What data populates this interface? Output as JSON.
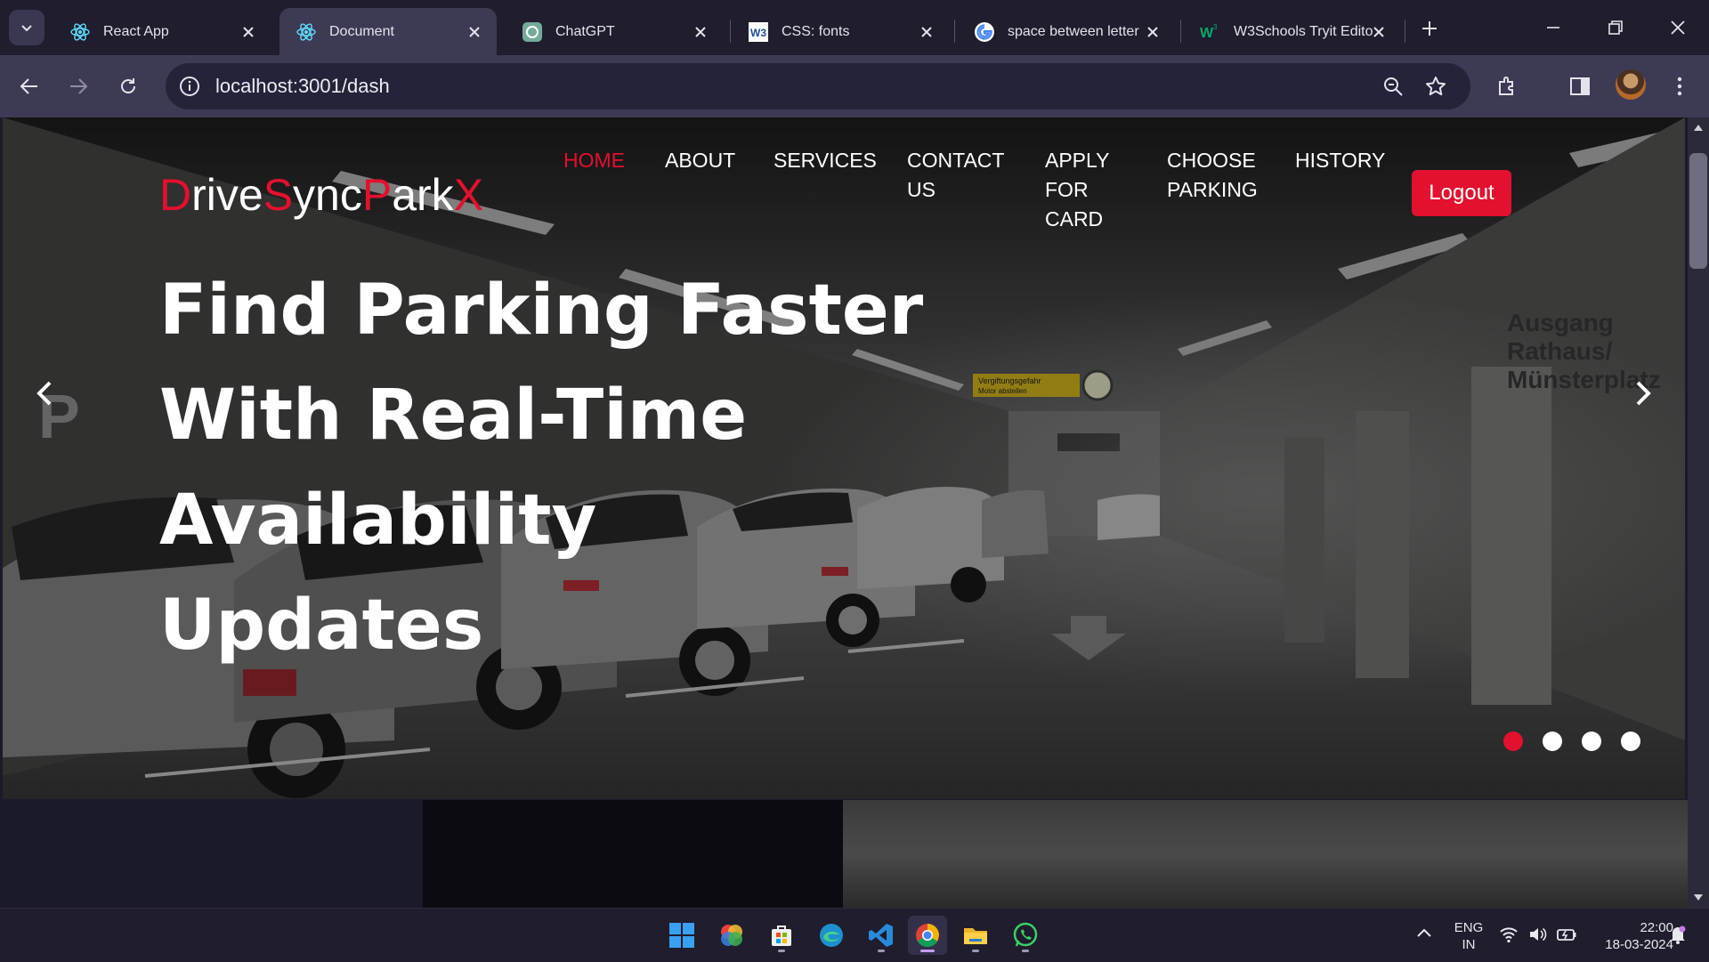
{
  "browser": {
    "tabs": [
      {
        "title": "React App",
        "icon": "react-icon",
        "active": false
      },
      {
        "title": "Document",
        "icon": "react-icon",
        "active": true
      },
      {
        "title": "ChatGPT",
        "icon": "chatgpt-icon",
        "active": false
      },
      {
        "title": "CSS: fonts",
        "icon": "w3-icon",
        "active": false
      },
      {
        "title": "space between letter",
        "icon": "google-icon",
        "active": false
      },
      {
        "title": "W3Schools Tryit Edito",
        "icon": "w3schools-icon",
        "active": false
      }
    ],
    "url": "localhost:3001/dash"
  },
  "site": {
    "logo": [
      {
        "cap": "D",
        "rest": "rive"
      },
      {
        "cap": "S",
        "rest": "ync"
      },
      {
        "cap": "P",
        "rest": "ark"
      },
      {
        "cap": "X",
        "rest": ""
      }
    ],
    "nav": {
      "home": "HOME",
      "about": "ABOUT",
      "services": "SERVICES",
      "contact_l1": "CONTACT",
      "contact_l2": "US",
      "apply_l1": "APPLY",
      "apply_l2": "FOR",
      "apply_l3": "CARD",
      "choose_l1": "CHOOSE",
      "choose_l2": "PARKING",
      "history": "HISTORY"
    },
    "logout_label": "Logout",
    "hero": {
      "line1": "Find Parking Faster",
      "line2": "With Real-Time",
      "line3": "Availability",
      "line4": "Updates",
      "sign_text_1": "Vergiftungsgefahr",
      "sign_text_2": "Motor abstellen",
      "wall_text_1": "Ausgang",
      "wall_text_2": "Rathaus/",
      "wall_text_3": "Münsterplatz"
    },
    "carousel": {
      "slides": 4,
      "active_index": 0
    },
    "colors": {
      "accent": "#e3102f"
    }
  },
  "taskbar": {
    "apps": [
      "windows-start",
      "color-app",
      "microsoft-store",
      "edge",
      "vscode",
      "chrome",
      "file-explorer",
      "whatsapp"
    ],
    "lang_1": "ENG",
    "lang_2": "IN",
    "time": "22:00",
    "date": "18-03-2024"
  }
}
